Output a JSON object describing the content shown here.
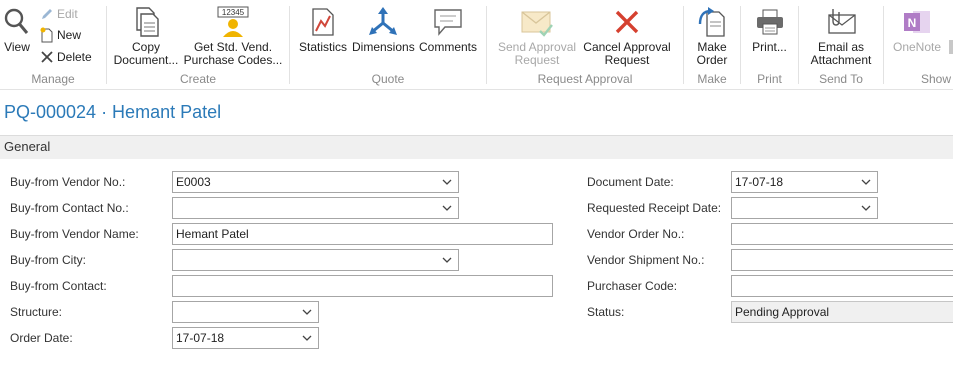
{
  "ribbon": {
    "manage": {
      "label": "Manage",
      "view": "View",
      "edit": "Edit",
      "new": "New",
      "delete": "Delete"
    },
    "create": {
      "label": "Create",
      "copy_document": "Copy Document...",
      "get_std_codes": "Get Std. Vend. Purchase Codes..."
    },
    "quote": {
      "label": "Quote",
      "statistics": "Statistics",
      "dimensions": "Dimensions",
      "comments": "Comments"
    },
    "request_approval": {
      "label": "Request Approval",
      "send": "Send Approval Request",
      "cancel": "Cancel Approval Request"
    },
    "make": {
      "label": "Make",
      "make_order": "Make Order"
    },
    "print": {
      "label": "Print",
      "print": "Print..."
    },
    "send_to": {
      "label": "Send To",
      "email": "Email as Attachment"
    },
    "show": {
      "label": "Show",
      "onenote": "OneNote"
    }
  },
  "page_title": "PQ-000024 · Hemant Patel",
  "section_title": "General",
  "fields_left": {
    "vendor_no": {
      "label": "Buy-from Vendor No.:",
      "value": "E0003"
    },
    "contact_no": {
      "label": "Buy-from Contact No.:",
      "value": ""
    },
    "vendor_name": {
      "label": "Buy-from Vendor Name:",
      "value": "Hemant Patel"
    },
    "city": {
      "label": "Buy-from City:",
      "value": ""
    },
    "contact": {
      "label": "Buy-from Contact:",
      "value": ""
    },
    "structure": {
      "label": "Structure:",
      "value": ""
    },
    "order_date": {
      "label": "Order Date:",
      "value": "17-07-18"
    }
  },
  "fields_right": {
    "document_date": {
      "label": "Document Date:",
      "value": "17-07-18"
    },
    "requested_receipt_date": {
      "label": "Requested Receipt Date:",
      "value": ""
    },
    "vendor_order_no": {
      "label": "Vendor Order No.:",
      "value": ""
    },
    "vendor_shipment_no": {
      "label": "Vendor Shipment No.:",
      "value": ""
    },
    "purchaser_code": {
      "label": "Purchaser Code:",
      "value": ""
    },
    "status": {
      "label": "Status:",
      "value": "Pending Approval"
    }
  }
}
